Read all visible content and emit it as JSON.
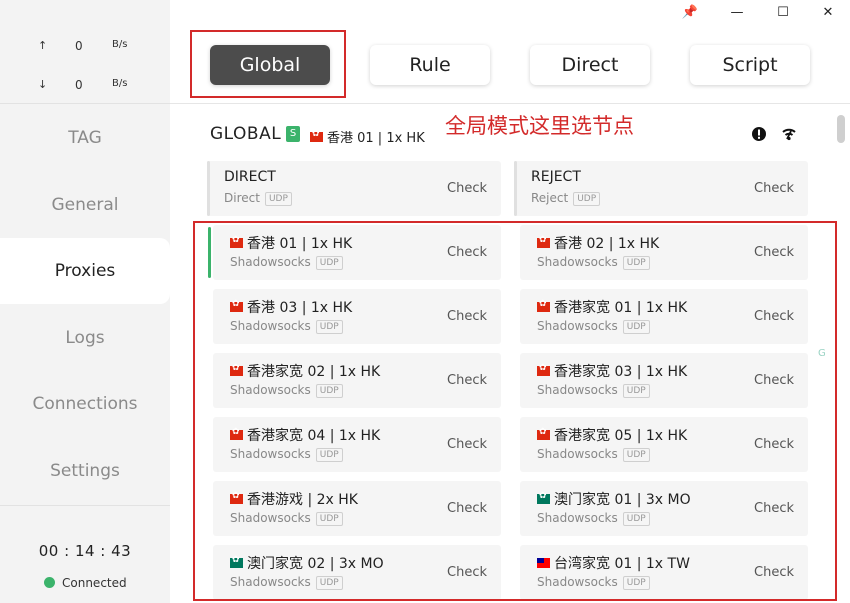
{
  "window": {
    "controls": {
      "pin": "📌",
      "minimize": "—",
      "maximize": "☐",
      "close": "✕"
    }
  },
  "traffic": {
    "up_arrow": "↑",
    "up_value": "0",
    "up_unit": "B/s",
    "down_arrow": "↓",
    "down_value": "0",
    "down_unit": "B/s"
  },
  "sidebar": {
    "items": [
      {
        "label": "TAG"
      },
      {
        "label": "General"
      },
      {
        "label": "Proxies"
      },
      {
        "label": "Logs"
      },
      {
        "label": "Connections"
      },
      {
        "label": "Settings"
      }
    ],
    "active": "Proxies"
  },
  "status": {
    "timer": "00 : 14 : 43",
    "connection": "Connected"
  },
  "modes": {
    "global": "Global",
    "rule": "Rule",
    "direct": "Direct",
    "script": "Script",
    "active": "Global"
  },
  "annotation": "全局模式这里选节点",
  "group": {
    "name": "GLOBAL",
    "badge": "S",
    "current": "香港 01 | 1x HK"
  },
  "proxies": {
    "direct": {
      "name": "DIRECT",
      "type": "Direct",
      "udp": "UDP",
      "check": "Check"
    },
    "reject": {
      "name": "REJECT",
      "type": "Reject",
      "udp": "UDP",
      "check": "Check"
    },
    "list": [
      {
        "flag": "hk",
        "name": "香港 01 | 1x HK",
        "type": "Shadowsocks",
        "udp": "UDP",
        "check": "Check",
        "selected": true
      },
      {
        "flag": "hk",
        "name": "香港 02 | 1x HK",
        "type": "Shadowsocks",
        "udp": "UDP",
        "check": "Check"
      },
      {
        "flag": "hk",
        "name": "香港 03 | 1x HK",
        "type": "Shadowsocks",
        "udp": "UDP",
        "check": "Check"
      },
      {
        "flag": "hk",
        "name": "香港家宽 01 | 1x HK",
        "type": "Shadowsocks",
        "udp": "UDP",
        "check": "Check"
      },
      {
        "flag": "hk",
        "name": "香港家宽 02 | 1x HK",
        "type": "Shadowsocks",
        "udp": "UDP",
        "check": "Check"
      },
      {
        "flag": "hk",
        "name": "香港家宽 03 | 1x HK",
        "type": "Shadowsocks",
        "udp": "UDP",
        "check": "Check"
      },
      {
        "flag": "hk",
        "name": "香港家宽 04 | 1x HK",
        "type": "Shadowsocks",
        "udp": "UDP",
        "check": "Check"
      },
      {
        "flag": "hk",
        "name": "香港家宽 05 | 1x HK",
        "type": "Shadowsocks",
        "udp": "UDP",
        "check": "Check"
      },
      {
        "flag": "hk",
        "name": "香港游戏 | 2x HK",
        "type": "Shadowsocks",
        "udp": "UDP",
        "check": "Check"
      },
      {
        "flag": "mo",
        "name": "澳门家宽 01 | 3x MO",
        "type": "Shadowsocks",
        "udp": "UDP",
        "check": "Check"
      },
      {
        "flag": "mo",
        "name": "澳门家宽 02 | 3x MO",
        "type": "Shadowsocks",
        "udp": "UDP",
        "check": "Check"
      },
      {
        "flag": "tw",
        "name": "台湾家宽 01 | 1x TW",
        "type": "Shadowsocks",
        "udp": "UDP",
        "check": "Check"
      }
    ]
  },
  "side_letter": "G",
  "colors": {
    "accent_green": "#3bb36b",
    "annotation_red": "#d32a2a",
    "active_mode_bg": "#4c4c4c"
  }
}
